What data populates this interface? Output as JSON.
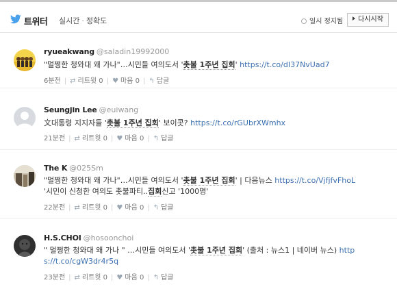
{
  "header": {
    "title": "트위터",
    "tab_realtime": "실시간",
    "tab_accuracy": "정확도",
    "pause_label": "일시 정지됨",
    "restart_label": "다시시작"
  },
  "tweets": [
    {
      "name": "ryueakwang",
      "handle": "@saladin19992000",
      "lines": [
        {
          "pre": "\"멀쩡한 청와대 왜 가나\"…시민들 여의도서 '",
          "hl": "촛불 1주년 집회",
          "post": "' ",
          "link": "https://t.co/dI37NvUad7"
        }
      ],
      "time": "6분전",
      "retweet": "리트윗 0",
      "like": "마음 0",
      "reply": "답글"
    },
    {
      "name": "Seungjin Lee",
      "handle": "@euiwang",
      "lines": [
        {
          "pre": "文대통령 지지자들 '",
          "hl": "촛불 1주년 집회",
          "post": "' 보이콧? ",
          "link": "https://t.co/rGUbrXWmhx"
        }
      ],
      "time": "21분전",
      "retweet": "리트윗 0",
      "like": "마음 0",
      "reply": "답글"
    },
    {
      "name": "The K",
      "handle": "@025Sm",
      "lines": [
        {
          "pre": "\"멀쩡한 청와대 왜 가나\"…시민들 여의도서 '",
          "hl": "촛불 1주년 집회",
          "post": "' | 다음뉴스 ",
          "link": "https://t.co/VjfjfvFhoL"
        },
        {
          "pre": "'시민이 신청한 여의도 촛불파티..",
          "hl": "집회",
          "post": "신고 '1000명'",
          "link": ""
        }
      ],
      "time": "22분전",
      "retweet": "리트윗 0",
      "like": "마음 0",
      "reply": "답글"
    },
    {
      "name": "H.S.CHOI",
      "handle": "@hosoonchoi",
      "lines": [
        {
          "pre": " \" 멀쩡한 청와대 왜 가나 \" …시민들 여의도서 '",
          "hl": "촛불 1주년 집회",
          "post": "' (출처 : 뉴스1 | 네이버 뉴스) ",
          "link": "http"
        },
        {
          "pre": "",
          "hl": "",
          "post": "",
          "link": "s://t.co/cgW3dr4r5q"
        }
      ],
      "time": "23분전",
      "retweet": "리트윗 0",
      "like": "마음 0",
      "reply": "답글"
    }
  ]
}
